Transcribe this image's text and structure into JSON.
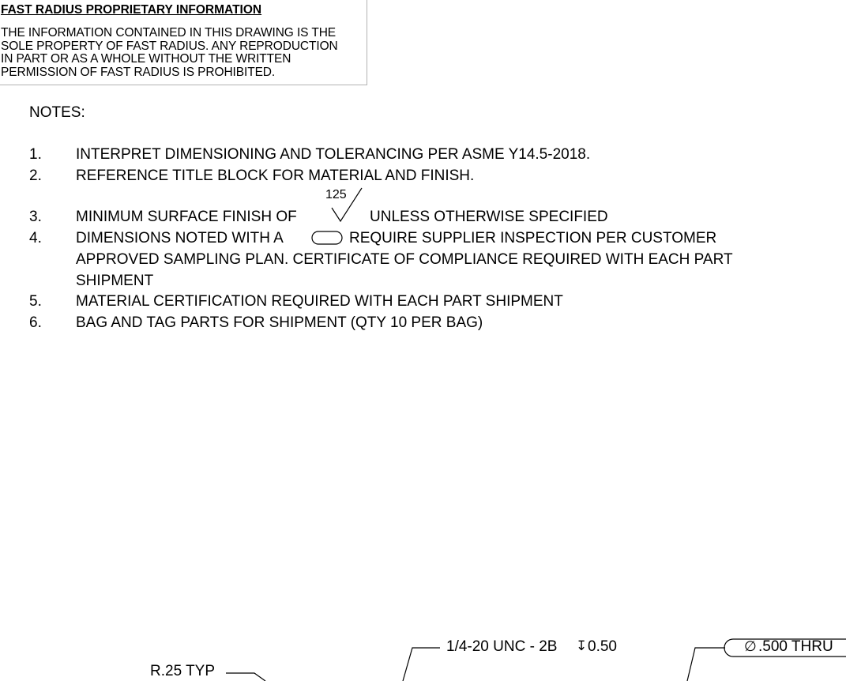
{
  "proprietary": {
    "title": "FAST RADIUS PROPRIETARY INFORMATION",
    "lines": [
      "THE INFORMATION CONTAINED IN THIS DRAWING IS THE",
      "SOLE PROPERTY OF FAST RADIUS. ANY REPRODUCTION",
      "IN PART OR AS A WHOLE WITHOUT THE WRITTEN",
      "PERMISSION OF FAST RADIUS IS PROHIBITED."
    ]
  },
  "notes": {
    "header": "NOTES:",
    "items": [
      {
        "num": "1.",
        "text": "INTERPRET DIMENSIONING AND TOLERANCING PER ASME Y14.5-2018."
      },
      {
        "num": "2.",
        "text": "REFERENCE TITLE BLOCK FOR MATERIAL AND FINISH."
      },
      {
        "num": "3.",
        "text_before": "MINIMUM SURFACE FINISH OF",
        "finish_value": "125",
        "text_after": "UNLESS OTHERWISE SPECIFIED"
      },
      {
        "num": "4.",
        "text_before": "DIMENSIONS NOTED WITH A",
        "text_after": "REQUIRE SUPPLIER INSPECTION PER CUSTOMER",
        "line2": "APPROVED SAMPLING PLAN. CERTIFICATE OF COMPLIANCE REQUIRED WITH EACH PART",
        "line3": "SHIPMENT"
      },
      {
        "num": "5.",
        "text": "MATERIAL CERTIFICATION REQUIRED WITH EACH PART SHIPMENT"
      },
      {
        "num": "6.",
        "text": "BAG AND TAG PARTS FOR SHIPMENT (QTY 10 PER BAG)"
      }
    ]
  },
  "callouts": {
    "radius": "R.25 TYP",
    "thread": "1/4-20 UNC - 2B",
    "thread_depth_symbol": "↧",
    "thread_depth": "0.50",
    "hole_symbol": "∅",
    "hole": ".500 THRU"
  }
}
